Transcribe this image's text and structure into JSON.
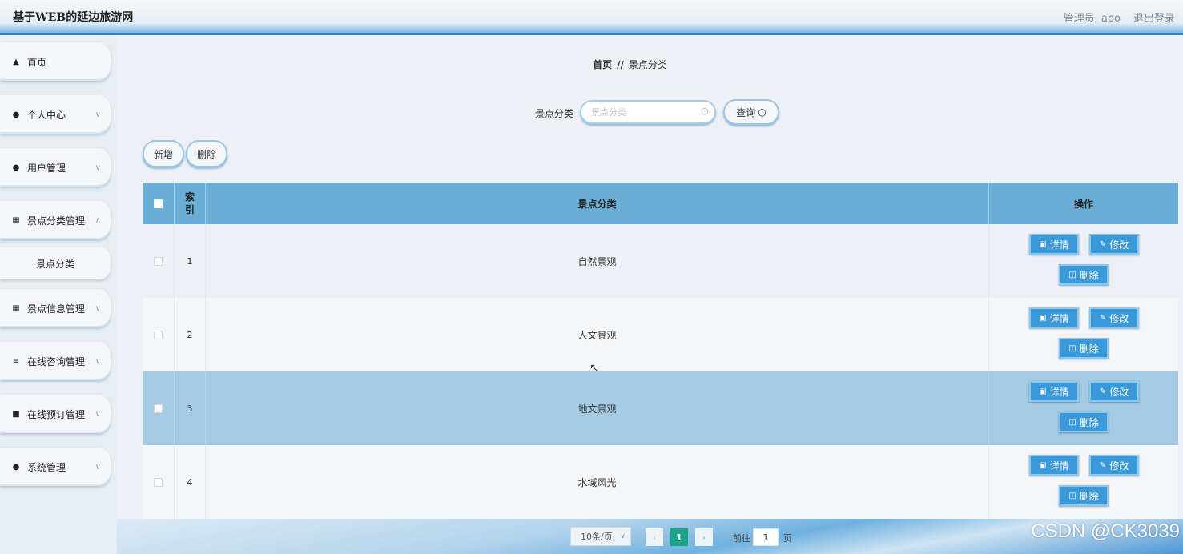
{
  "header": {
    "title": "基于WEB的延边旅游网",
    "role_label": "管理员",
    "username": "abo",
    "logout": "退出登录"
  },
  "sidebar": {
    "items": [
      {
        "label": "首页",
        "icon": "home-icon"
      },
      {
        "label": "个人中心",
        "icon": "user-icon"
      },
      {
        "label": "用户管理",
        "icon": "user-icon"
      },
      {
        "label": "景点分类管理",
        "icon": "grid-icon"
      },
      {
        "label": "景点分类",
        "icon": ""
      },
      {
        "label": "景点信息管理",
        "icon": "grid-icon"
      },
      {
        "label": "在线咨询管理",
        "icon": "sliders-icon"
      },
      {
        "label": "在线预订管理",
        "icon": "chat-icon"
      },
      {
        "label": "系统管理",
        "icon": "pin-icon"
      }
    ]
  },
  "breadcrumb": {
    "home": "首页",
    "sep": "//",
    "current": "景点分类"
  },
  "search": {
    "label": "景点分类",
    "placeholder": "景点分类",
    "button": "查询"
  },
  "actions": {
    "add": "新增",
    "delete": "删除"
  },
  "table": {
    "headers": {
      "index_line1": "索",
      "index_line2": "引",
      "name": "景点分类",
      "operations": "操作"
    },
    "rows": [
      {
        "index": "1",
        "name": "自然景观"
      },
      {
        "index": "2",
        "name": "人文景观"
      },
      {
        "index": "3",
        "name": "地文景观"
      },
      {
        "index": "4",
        "name": "水域风光"
      }
    ],
    "op_labels": {
      "detail": "详情",
      "edit": "修改",
      "delete": "删除"
    }
  },
  "pagination": {
    "page_size": "10条/页",
    "current_page": "1",
    "goto_label": "前往",
    "goto_value": "1",
    "page_suffix": "页"
  },
  "watermark": "CSDN @CK3039",
  "colors": {
    "header_accent": "#3b8fd0",
    "table_header": "#6aaed6",
    "op_button": "#3a9ad9",
    "row_highlight": "#a4cbe2",
    "pager_active": "#1aa58a"
  }
}
